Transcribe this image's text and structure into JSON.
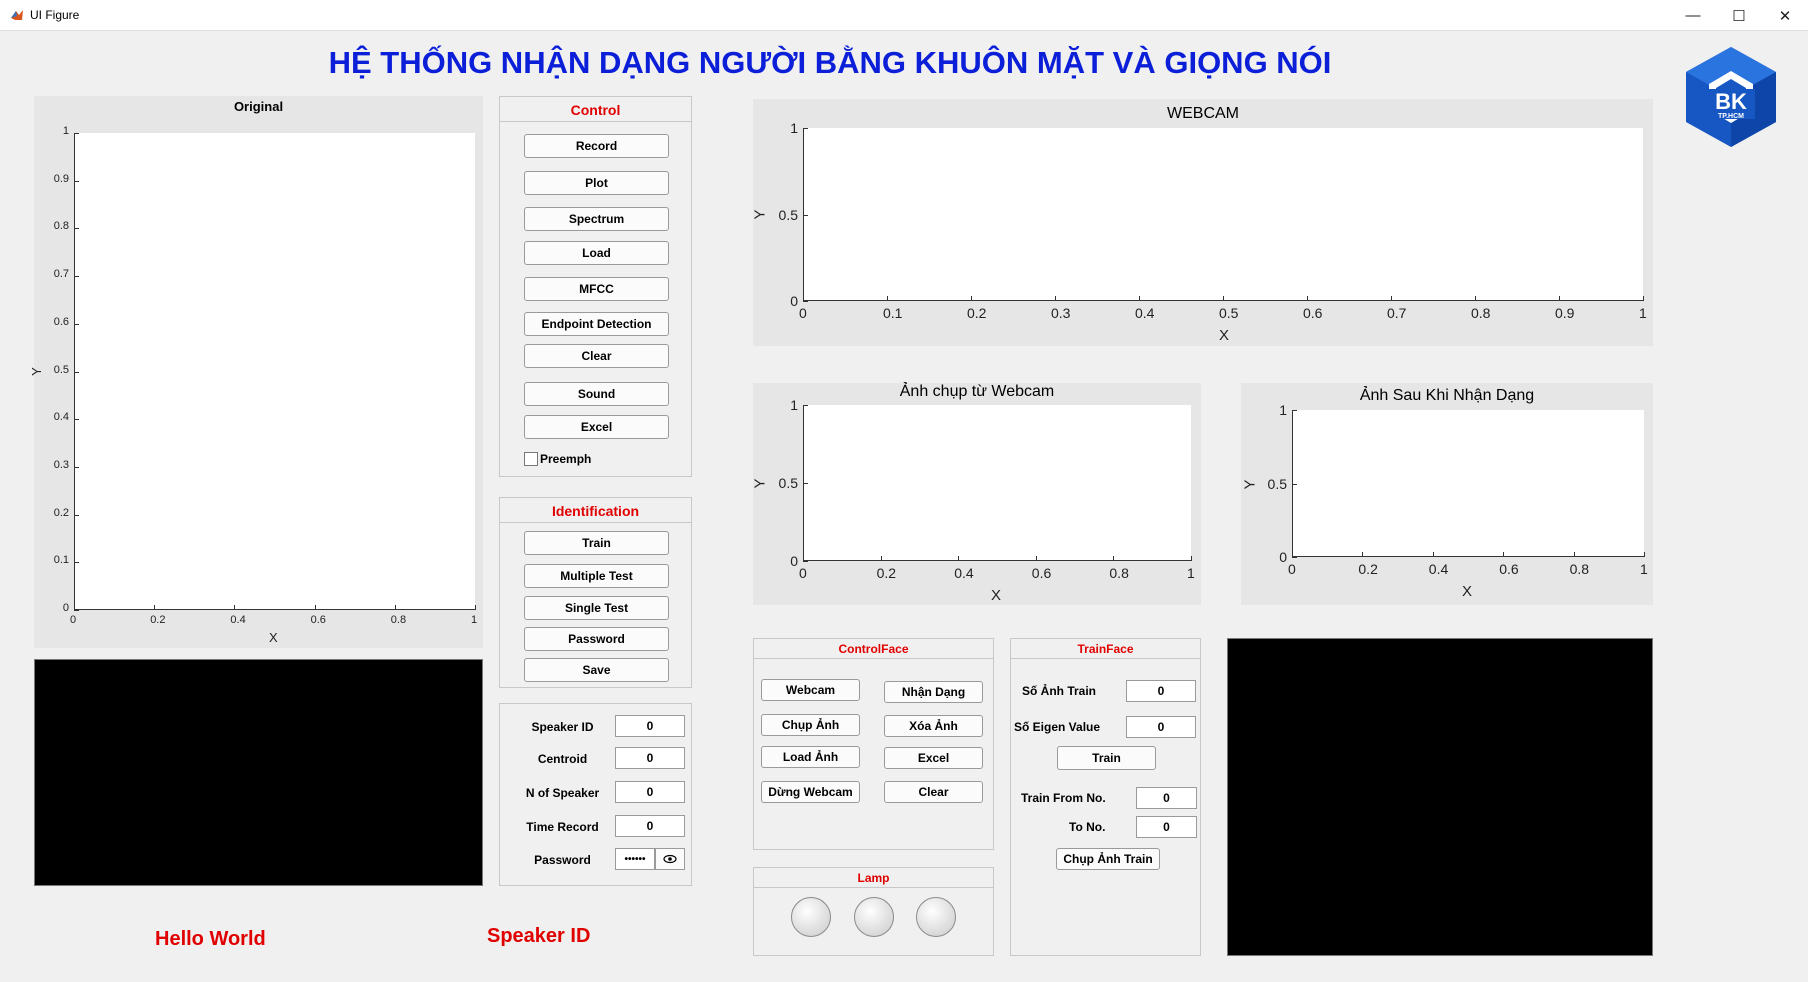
{
  "window": {
    "title": "UI Figure",
    "controls": [
      "—",
      "☐",
      "✕"
    ]
  },
  "app_title": "HỆ THỐNG NHẬN DẠNG NGƯỜI BẰNG KHUÔN MẶT VÀ GIỌNG NÓI",
  "logo": {
    "text": "BK",
    "subtext": "TP.HCM",
    "color": "#1757c4"
  },
  "axes": {
    "original": {
      "title": "Original",
      "xlabel": "X",
      "ylabel": "Y",
      "xticks": [
        "0",
        "0.2",
        "0.4",
        "0.6",
        "0.8",
        "1"
      ],
      "yticks": [
        "0",
        "0.1",
        "0.2",
        "0.3",
        "0.4",
        "0.5",
        "0.6",
        "0.7",
        "0.8",
        "0.9",
        "1"
      ]
    },
    "webcam": {
      "title": "WEBCAM",
      "xlabel": "X",
      "ylabel": "Y",
      "xticks": [
        "0",
        "0.1",
        "0.2",
        "0.3",
        "0.4",
        "0.5",
        "0.6",
        "0.7",
        "0.8",
        "0.9",
        "1"
      ],
      "yticks": [
        "0",
        "0.5",
        "1"
      ]
    },
    "capture": {
      "title": "Ảnh chụp từ Webcam",
      "xlabel": "X",
      "ylabel": "Y",
      "xticks": [
        "0",
        "0.2",
        "0.4",
        "0.6",
        "0.8",
        "1"
      ],
      "yticks": [
        "0",
        "0.5",
        "1"
      ]
    },
    "recognized": {
      "title": "Ảnh Sau Khi Nhận Dạng",
      "xlabel": "X",
      "ylabel": "Y",
      "xticks": [
        "0",
        "0.2",
        "0.4",
        "0.6",
        "0.8",
        "1"
      ],
      "yticks": [
        "0",
        "0.5",
        "1"
      ]
    }
  },
  "control": {
    "title": "Control",
    "buttons": [
      "Record",
      "Plot",
      "Spectrum",
      "Load",
      "MFCC",
      "Endpoint Detection",
      "Clear",
      "Sound",
      "Excel"
    ],
    "checkbox": {
      "label": "Preemph",
      "checked": false
    }
  },
  "identification": {
    "title": "Identification",
    "buttons": [
      "Train",
      "Multiple Test",
      "Single Test",
      "Password",
      "Save"
    ]
  },
  "speaker_fields": [
    {
      "label": "Speaker ID",
      "value": "0"
    },
    {
      "label": "Centroid",
      "value": "0"
    },
    {
      "label": "N of Speaker",
      "value": "0"
    },
    {
      "label": "Time Record",
      "value": "0"
    },
    {
      "label": "Password",
      "value": "••••••"
    }
  ],
  "control_face": {
    "title": "ControlFace",
    "left_buttons": [
      "Webcam",
      "Chụp Ảnh",
      "Load Ảnh",
      "Dừng Webcam"
    ],
    "right_buttons": [
      "Nhận Dạng",
      "Xóa Ảnh",
      "Excel",
      "Clear"
    ]
  },
  "lamp": {
    "title": "Lamp",
    "count": 3
  },
  "train_face": {
    "title": "TrainFace",
    "so_anh_train": {
      "label": "Số Ảnh Train",
      "value": "0"
    },
    "so_eigen": {
      "label": "Số Eigen Value",
      "value": "0"
    },
    "train_button": "Train",
    "train_from": {
      "label": "Train From No.",
      "value": "0"
    },
    "to_no": {
      "label": "To No.",
      "value": "0"
    },
    "chup_anh_train": "Chụp Ảnh Train"
  },
  "bottom_texts": {
    "hello": "Hello World",
    "speaker_id": "Speaker ID"
  }
}
